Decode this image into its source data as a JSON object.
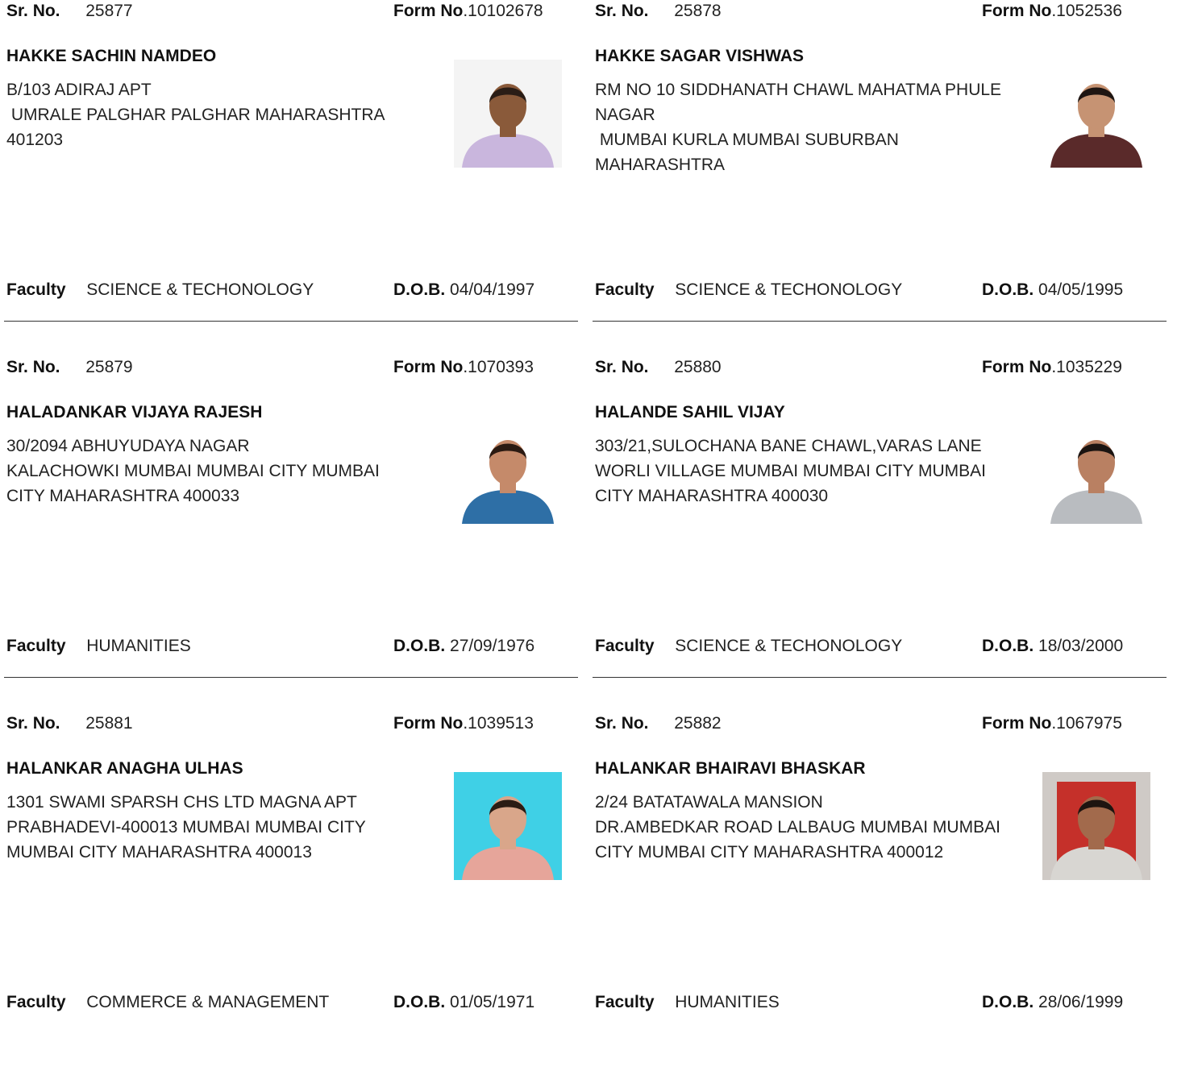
{
  "labels": {
    "sr": "Sr. No.",
    "form": "Form No",
    "faculty": "Faculty",
    "dob": "D.O.B."
  },
  "records": [
    {
      "sr_no": "25877",
      "form_no": ".10102678",
      "name": "HAKKE SACHIN NAMDEO",
      "address": [
        "B/103 ADIRAJ APT",
        " UMRALE PALGHAR PALGHAR MAHARASHTRA",
        "401203"
      ],
      "faculty": "SCIENCE & TECHONOLOGY",
      "dob": "04/04/1997",
      "photo": {
        "bg": "#f4f4f4",
        "shirt": "#c9b6dd",
        "skin": "#8a5a3a",
        "hair": "#2a1d16"
      }
    },
    {
      "sr_no": "25878",
      "form_no": ".1052536",
      "name": "HAKKE SAGAR VISHWAS",
      "address": [
        "RM NO 10 SIDDHANATH CHAWL MAHATMA PHULE",
        "NAGAR",
        " MUMBAI KURLA MUMBAI SUBURBAN",
        "MAHARASHTRA"
      ],
      "faculty": "SCIENCE & TECHONOLOGY",
      "dob": "04/05/1995",
      "photo": {
        "bg": "#ffffff",
        "shirt": "#5a2a2a",
        "skin": "#c69373",
        "hair": "#1e1512"
      }
    },
    {
      "sr_no": "25879",
      "form_no": ".1070393",
      "name": "HALADANKAR VIJAYA RAJESH",
      "address": [
        "30/2094 ABHUYUDAYA NAGAR",
        "KALACHOWKI MUMBAI MUMBAI CITY MUMBAI",
        "CITY MAHARASHTRA 400033"
      ],
      "faculty": "HUMANITIES",
      "dob": "27/09/1976",
      "photo": {
        "bg": "#ffffff",
        "shirt": "#2e6fa6",
        "skin": "#c58a6a",
        "hair": "#2b1a12"
      }
    },
    {
      "sr_no": "25880",
      "form_no": ".1035229",
      "name": "HALANDE SAHIL VIJAY",
      "address": [
        "303/21,SULOCHANA BANE CHAWL,VARAS LANE",
        "WORLI VILLAGE MUMBAI MUMBAI CITY MUMBAI",
        "CITY MAHARASHTRA 400030"
      ],
      "faculty": "SCIENCE & TECHONOLOGY",
      "dob": "18/03/2000",
      "photo": {
        "bg": "#ffffff",
        "shirt": "#b9bcc0",
        "skin": "#b98062",
        "hair": "#1b1411"
      }
    },
    {
      "sr_no": "25881",
      "form_no": ".1039513",
      "name": "HALANKAR ANAGHA ULHAS",
      "address": [
        "1301 SWAMI SPARSH CHS LTD MAGNA APT",
        "PRABHADEVI-400013 MUMBAI MUMBAI CITY",
        "MUMBAI CITY MAHARASHTRA 400013"
      ],
      "faculty": "COMMERCE & MANAGEMENT",
      "dob": "01/05/1971",
      "photo": {
        "bg": "#3fd0e6",
        "shirt": "#e6a59a",
        "skin": "#d9a68a",
        "hair": "#2b1c14"
      }
    },
    {
      "sr_no": "25882",
      "form_no": ".1067975",
      "name": "HALANKAR BHAIRAVI BHASKAR",
      "address": [
        "2/24 BATATAWALA MANSION",
        "DR.AMBEDKAR ROAD LALBAUG MUMBAI MUMBAI",
        "CITY MUMBAI CITY MAHARASHTRA 400012"
      ],
      "faculty": "HUMANITIES",
      "dob": "28/06/1999",
      "photo": {
        "bg": "#cfcac6",
        "inner": "#c5302a",
        "shirt": "#d8d6d2",
        "skin": "#a26a4c",
        "hair": "#1e1410"
      }
    }
  ]
}
